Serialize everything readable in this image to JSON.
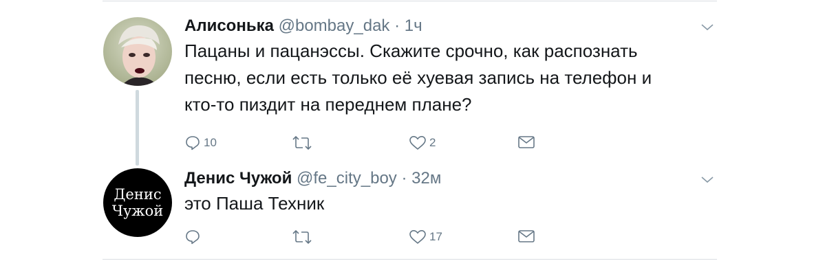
{
  "tweets": [
    {
      "author": "Алисонька",
      "handle": "@bombay_dak",
      "separator": "·",
      "time": "1ч",
      "text": "Пацаны и пацанэссы. Скажите срочно, как распознать\nпесню, если есть только её хуевая запись на телефон и\nкто-то пиздит на переднем плане?",
      "replies": "10",
      "retweets": "",
      "likes": "2"
    },
    {
      "author": "Денис Чужой",
      "handle": "@fe_city_boy",
      "separator": "·",
      "time": "32м",
      "avatar_text_line1": "Денис",
      "avatar_text_line2": "Чужой",
      "text": "это Паша Техник",
      "replies": "",
      "retweets": "",
      "likes": "17"
    }
  ],
  "icons": {
    "reply": "reply-icon",
    "retweet": "retweet-icon",
    "like": "heart-icon",
    "dm": "envelope-icon",
    "menu": "chevron-down-icon"
  },
  "colors": {
    "icon_gray": "#657786",
    "divider": "#d9dde1",
    "thread_line": "#cfd9de"
  }
}
